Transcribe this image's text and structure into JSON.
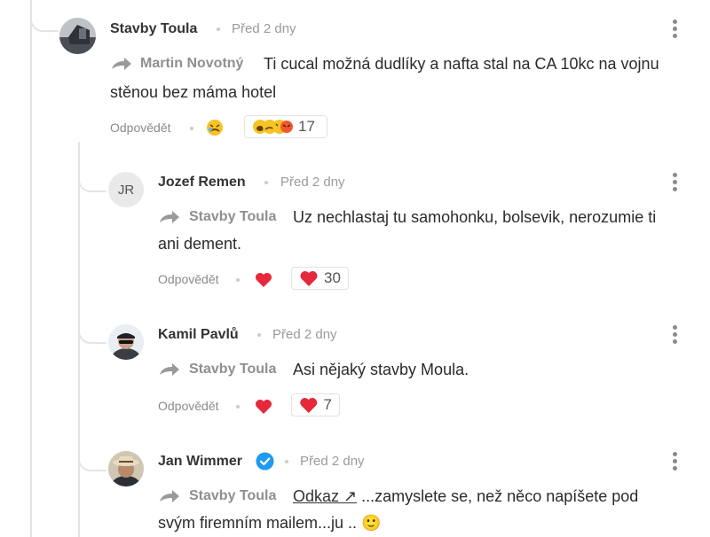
{
  "comments": [
    {
      "author": "Stavby Toula",
      "time": "Před 2 dny",
      "reply_to": "Martin Novotný",
      "text_line1": "Ti cucal možná dudlíky a nafta stal na CA 10kc na vojnu",
      "text_line2": "stěnou bez máma hotel",
      "reply_label": "Odpovědět",
      "reaction_count": "17",
      "avatar": "photo"
    },
    {
      "author": "Jozef Remen",
      "initials": "JR",
      "time": "Před 2 dny",
      "reply_to": "Stavby Toula",
      "text_line1": "Uz nechlastaj tu samohonku, bolsevik, nerozumie ti",
      "text_line2": "ani dement.",
      "reply_label": "Odpovědět",
      "reaction_count": "30",
      "reaction_color": "#e5283a"
    },
    {
      "author": "Kamil Pavlů",
      "time": "Před 2 dny",
      "reply_to": "Stavby Toula",
      "text_line1": "Asi nějaký stavby Moula.",
      "reply_label": "Odpovědět",
      "reaction_count": "7",
      "reaction_color": "#e5283a"
    },
    {
      "author": "Jan Wimmer",
      "verified": true,
      "time": "Před 2 dny",
      "reply_to": "Stavby Toula",
      "link_text": "Odkaz ↗",
      "text_line1": " ...zamyslete se, než něco napíšete pod",
      "text_line2": "svým firemním mailem...ju .. 🙂",
      "verified_color": "#1d9bf0"
    }
  ]
}
